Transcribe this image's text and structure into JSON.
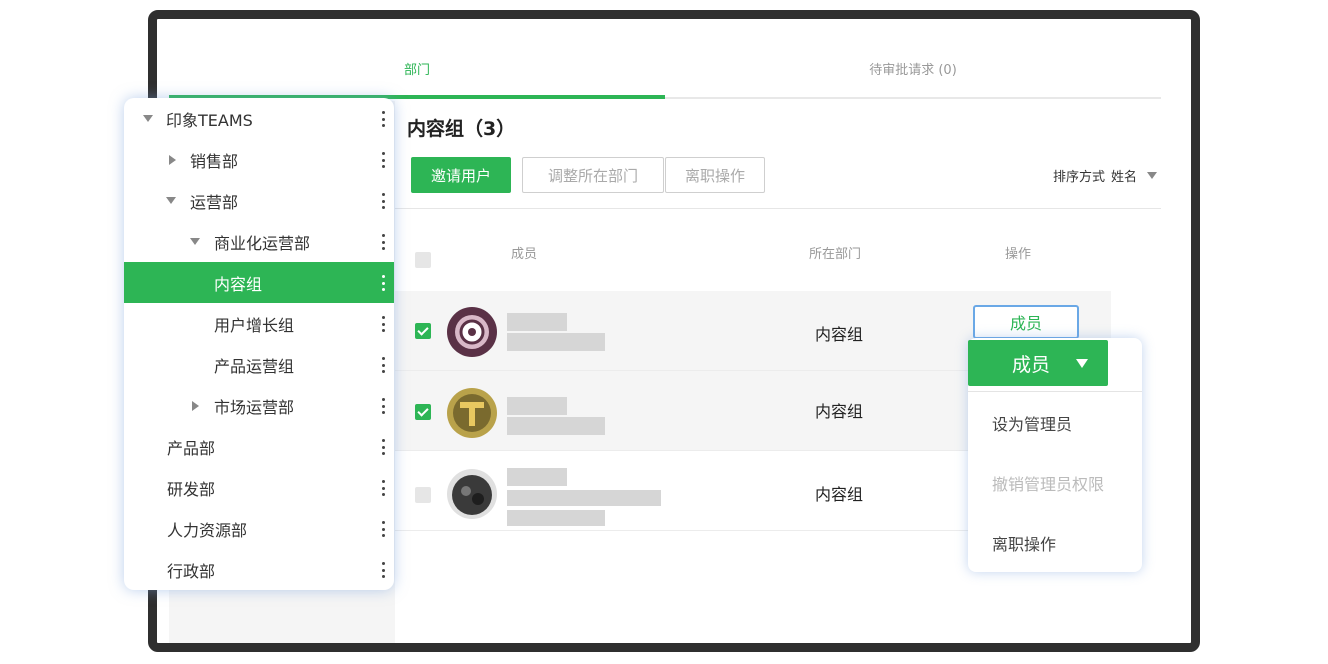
{
  "tabs": [
    {
      "label": "部门",
      "active": true
    },
    {
      "label": "待审批请求 (0)",
      "active": false
    }
  ],
  "section": {
    "title": "内容组（3）"
  },
  "toolbar": {
    "invite": "邀请用户",
    "adjust": "调整所在部门",
    "leave": "离职操作",
    "sort_label": "排序方式",
    "sort_value": "姓名"
  },
  "table": {
    "headers": {
      "member": "成员",
      "dept": "所在部门",
      "action": "操作"
    },
    "rows": [
      {
        "dept": "内容组",
        "checked": true
      },
      {
        "dept": "内容组",
        "checked": true
      },
      {
        "dept": "内容组",
        "checked": false
      }
    ]
  },
  "role_button": "成员",
  "dropdown": {
    "selected": "成员",
    "items": [
      {
        "label": "设为管理员",
        "disabled": false
      },
      {
        "label": "撤销管理员权限",
        "disabled": true
      },
      {
        "label": "离职操作",
        "disabled": false
      }
    ]
  },
  "tree": [
    {
      "label": "印象TEAMS",
      "expander": "down"
    },
    {
      "label": "销售部",
      "expander": "right"
    },
    {
      "label": "运营部",
      "expander": "down"
    },
    {
      "label": "商业化运营部",
      "expander": "down"
    },
    {
      "label": "内容组",
      "expander": "none",
      "active": true
    },
    {
      "label": "用户增长组",
      "expander": "none"
    },
    {
      "label": "产品运营组",
      "expander": "none"
    },
    {
      "label": "市场运营部",
      "expander": "right"
    },
    {
      "label": "产品部",
      "expander": "none"
    },
    {
      "label": "研发部",
      "expander": "none"
    },
    {
      "label": "人力资源部",
      "expander": "none"
    },
    {
      "label": "行政部",
      "expander": "none"
    }
  ],
  "colors": {
    "accent": "#2db555",
    "focus_border": "#6aa8e6",
    "frame": "#2f2f2f"
  }
}
